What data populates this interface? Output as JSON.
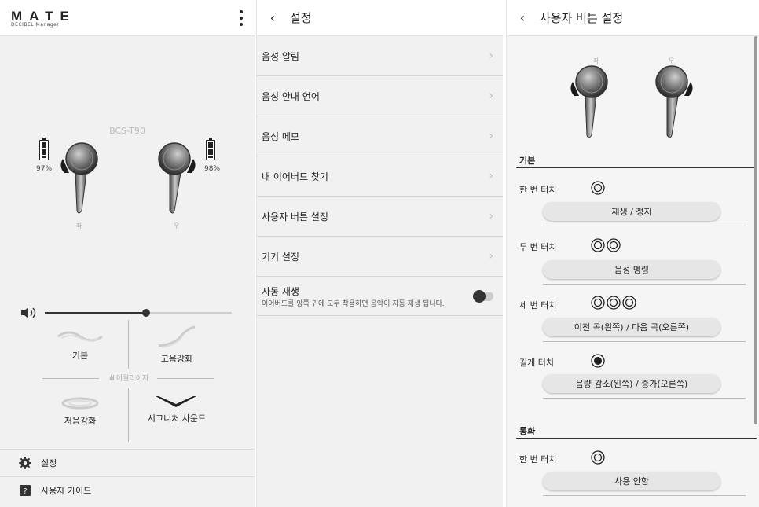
{
  "home": {
    "logo": "MATE",
    "logo_sub": "DECIBEL Manager",
    "model": "BCS-T90",
    "left_battery_pct": "97%",
    "right_battery_pct": "98%",
    "left_battery_level": 0.97,
    "right_battery_level": 0.98,
    "left_label": "좌",
    "right_label": "우",
    "volume_level": 0.54,
    "equalizer": {
      "title": "이퀄라이저",
      "presets": [
        "기본",
        "고음강화",
        "저음강화",
        "시그니처 사운드"
      ]
    },
    "menu": [
      {
        "icon": "gear-icon",
        "label": "설정"
      },
      {
        "icon": "user-guide-icon",
        "label": "사용자 가이드"
      }
    ]
  },
  "settings": {
    "back": "‹",
    "title": "설정",
    "items": [
      "음성 알림",
      "음성 안내 언어",
      "음성 메모",
      "내 이어버드 찾기",
      "사용자 버튼 설정",
      "기기 설정"
    ],
    "auto_play": {
      "title": "자동 재생",
      "desc": "이어버드를 양쪽 귀에 모두 착용하면 음악이 자동 재생 됩니다.",
      "enabled": false
    }
  },
  "user_button": {
    "back": "‹",
    "title": "사용자 버튼 설정",
    "left_label": "좌",
    "right_label": "우",
    "sections": [
      {
        "title": "기본",
        "gestures": [
          {
            "label": "한 번 터치",
            "icon": "single-tap-icon",
            "action": "재생 / 정지"
          },
          {
            "label": "두 번 터치",
            "icon": "double-tap-icon",
            "action": "음성 명령"
          },
          {
            "label": "세 번 터치",
            "icon": "triple-tap-icon",
            "action": "이전 곡(왼쪽) / 다음 곡(오른쪽)"
          },
          {
            "label": "길게 터치",
            "icon": "long-press-icon",
            "action": "음량 감소(왼쪽) / 증가(오른쪽)"
          }
        ]
      },
      {
        "title": "통화",
        "gestures": [
          {
            "label": "한 번 터치",
            "icon": "single-tap-icon",
            "action": "사용 안함"
          }
        ]
      }
    ]
  }
}
